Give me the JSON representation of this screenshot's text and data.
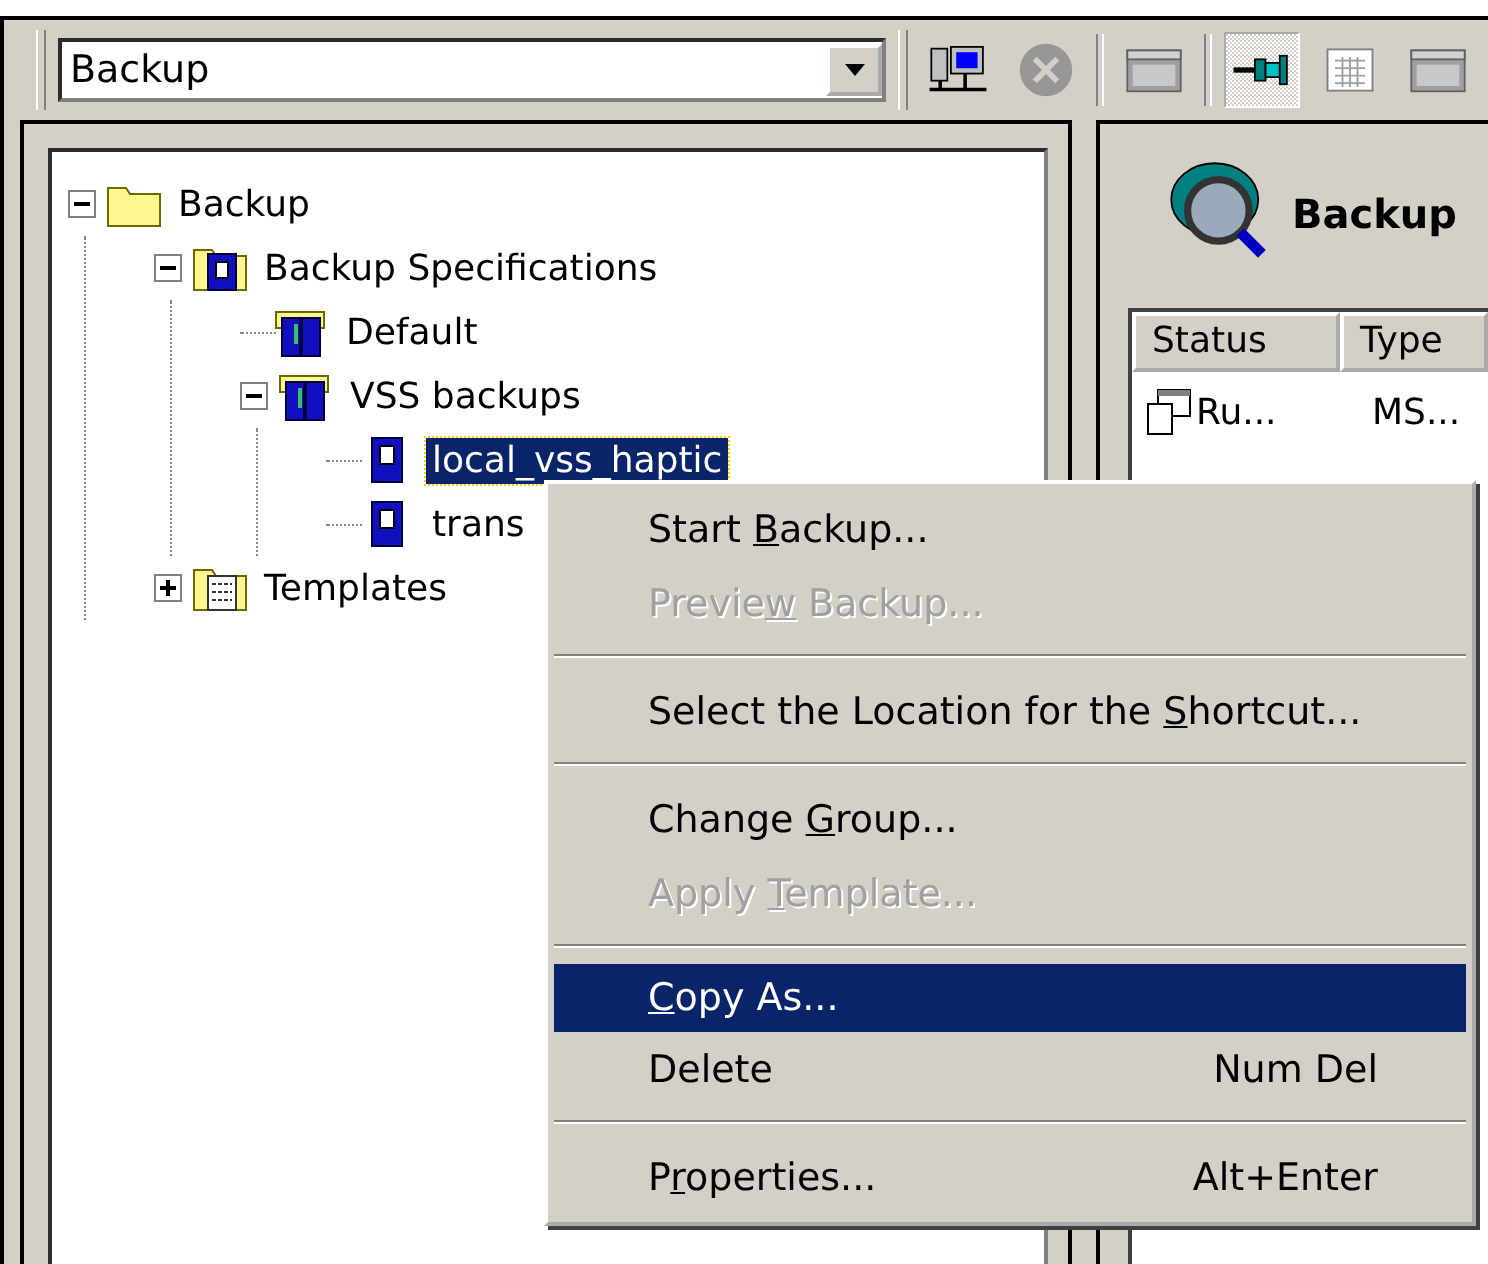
{
  "toolbar": {
    "combo": {
      "value": "Backup"
    },
    "buttons": [
      {
        "kind": "computer",
        "pressed": false,
        "disabled": false
      },
      {
        "kind": "stop",
        "pressed": false,
        "disabled": true
      },
      {
        "kind": "window",
        "pressed": false,
        "disabled": false
      },
      {
        "kind": "pin",
        "pressed": true,
        "disabled": false
      },
      {
        "kind": "grid",
        "pressed": false,
        "disabled": false
      },
      {
        "kind": "window",
        "pressed": false,
        "disabled": false
      }
    ]
  },
  "tree": [
    {
      "label": "Backup",
      "kind": "folder",
      "expanded": true,
      "selected": false,
      "children": [
        {
          "label": "Backup Specifications",
          "kind": "spec-folder",
          "expanded": true,
          "selected": false,
          "children": [
            {
              "label": "Default",
              "kind": "group",
              "selected": false
            },
            {
              "label": "VSS backups",
              "kind": "group",
              "expanded": true,
              "selected": false,
              "children": [
                {
                  "label": "local_vss_haptic",
                  "kind": "spec",
                  "selected": true
                },
                {
                  "label": "trans",
                  "kind": "spec",
                  "selected": false
                }
              ]
            }
          ]
        },
        {
          "label": "Templates",
          "kind": "template-folder",
          "expanded": false,
          "selected": false
        }
      ]
    }
  ],
  "right_pane": {
    "title": "Backup",
    "table": {
      "columns": [
        "Status",
        "Type"
      ],
      "rows": [
        [
          "Ru...",
          "MS..."
        ]
      ]
    }
  },
  "context_menu": [
    {
      "kind": "item",
      "before": "Start ",
      "key": "B",
      "after": "ackup...",
      "disabled": false,
      "selected": false
    },
    {
      "kind": "item",
      "before": "Previe",
      "key": "w",
      "after": " Backup...",
      "disabled": true,
      "selected": false
    },
    {
      "kind": "separator"
    },
    {
      "kind": "item",
      "before": "Select the Location for the ",
      "key": "S",
      "after": "hortcut...",
      "disabled": false,
      "selected": false
    },
    {
      "kind": "separator"
    },
    {
      "kind": "item",
      "before": "Change ",
      "key": "G",
      "after": "roup...",
      "disabled": false,
      "selected": false
    },
    {
      "kind": "item",
      "before": "Apply ",
      "key": "T",
      "after": "emplate...",
      "disabled": true,
      "selected": false
    },
    {
      "kind": "separator"
    },
    {
      "kind": "item",
      "key": "C",
      "after": "opy As...",
      "disabled": false,
      "selected": true
    },
    {
      "kind": "item",
      "before": "Delete",
      "shortcut": "Num Del",
      "disabled": false,
      "selected": false
    },
    {
      "kind": "separator"
    },
    {
      "kind": "item",
      "before": "P",
      "key": "r",
      "after": "operties...",
      "shortcut": "Alt+Enter",
      "disabled": false,
      "selected": false
    }
  ]
}
